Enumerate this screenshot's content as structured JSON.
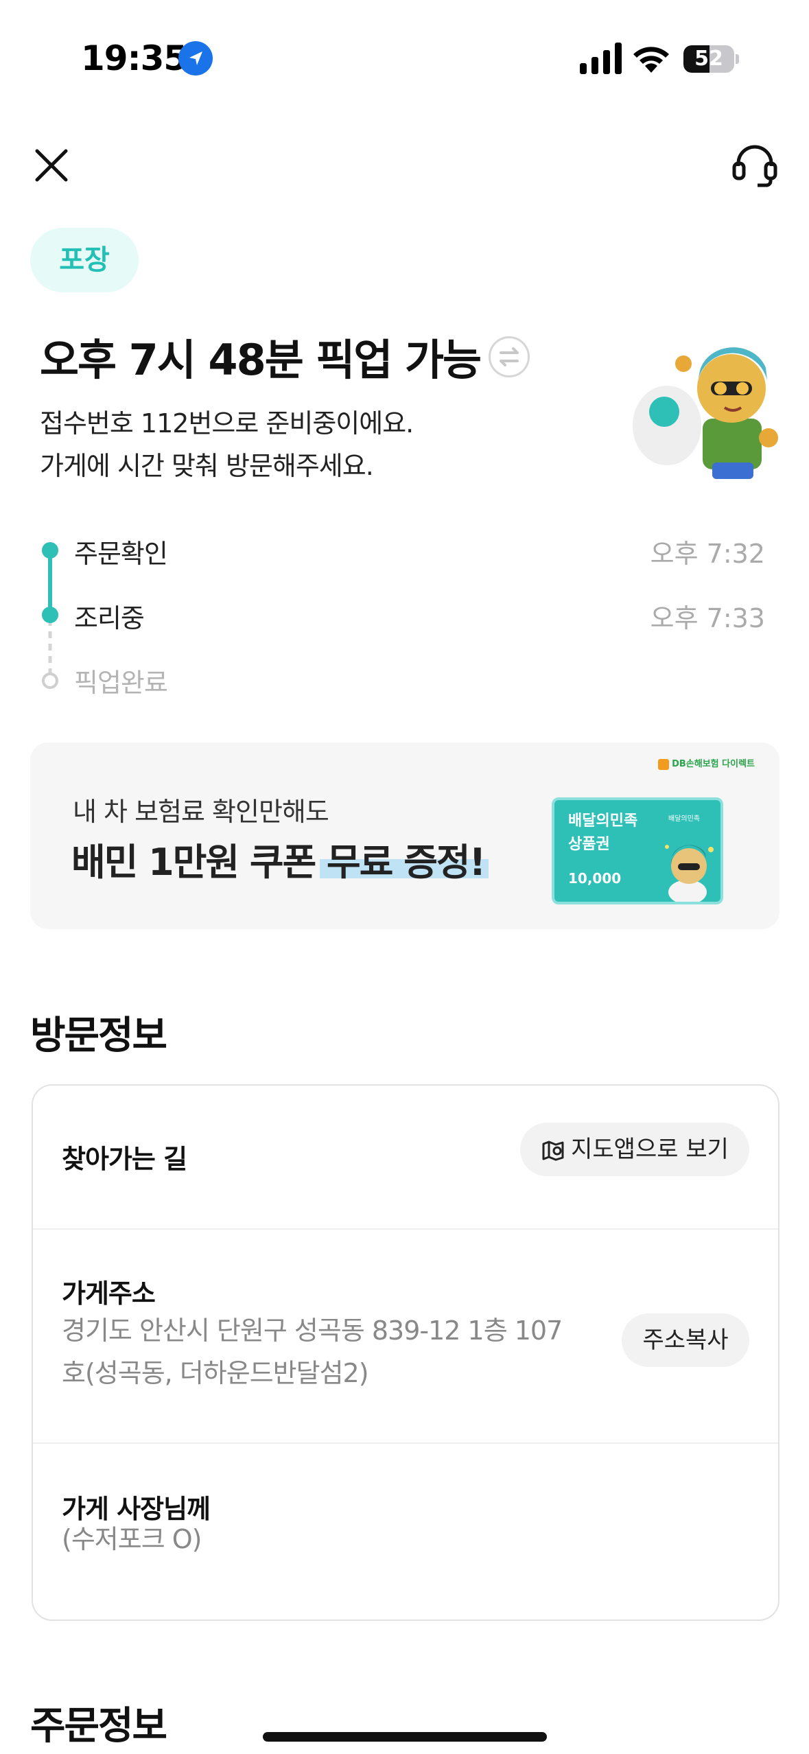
{
  "status_bar": {
    "time": "19:35",
    "battery": "52",
    "battery_level": 0.52
  },
  "header": {
    "close_icon": "close-icon",
    "support_icon": "headset-icon"
  },
  "order_type_tag": "포장",
  "headline": "오후 7시 48분 픽업 가능",
  "subtext": {
    "line1": "접수번호 112번으로 준비중이에요.",
    "line2": "가게에 시간 맞춰 방문해주세요."
  },
  "steps": [
    {
      "label": "주문확인",
      "time": "오후 7:32",
      "done": true
    },
    {
      "label": "조리중",
      "time": "오후 7:33",
      "done": true
    },
    {
      "label": "픽업완료",
      "time": "",
      "done": false
    }
  ],
  "banner": {
    "line1": "내 차 보험료 확인만해도",
    "line2": "배민 1만원 쿠폰 무료 증정!",
    "sponsor": "DB손해보험 다이렉트",
    "voucher_title_1": "배달의민족",
    "voucher_title_2": "상품권",
    "voucher_brand": "배달의민족",
    "voucher_amount": "10,000"
  },
  "visit_info": {
    "section_title": "방문정보",
    "directions_label": "찾아가는 길",
    "map_button": "지도앱으로 보기",
    "address_label": "가게주소",
    "address_line1": "경기도 안산시 단원구 성곡동 839-12 1층 107",
    "address_line2": "호(성곡동, 더하운드반달섬2)",
    "copy_button": "주소복사",
    "owner_label": "가게 사장님께",
    "owner_note": "(수저포크 O)"
  },
  "order_info": {
    "section_title": "주문정보"
  },
  "colors": {
    "accent": "#2ec0b7",
    "tag_bg": "#e6faf8",
    "muted": "#aaaaaa"
  }
}
